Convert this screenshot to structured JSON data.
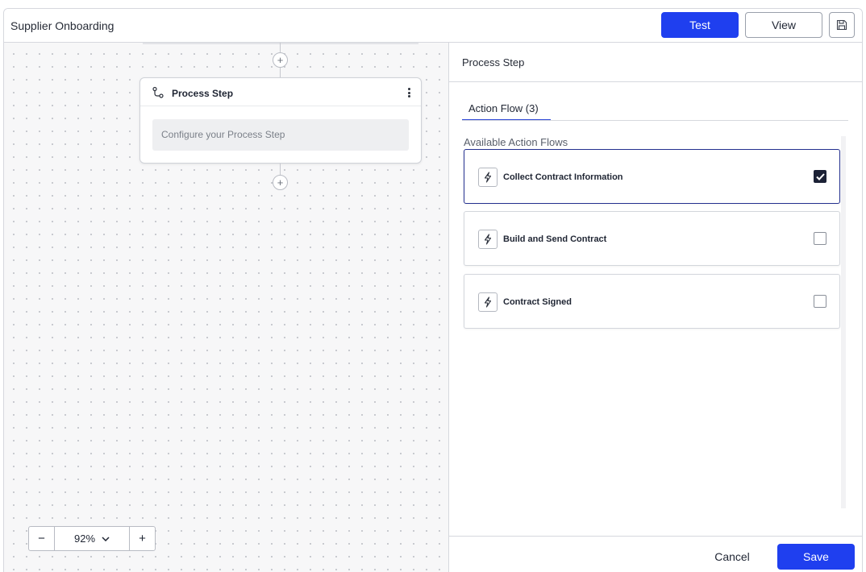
{
  "header": {
    "title": "Supplier Onboarding",
    "test_label": "Test",
    "view_label": "View",
    "save_icon": "floppy-disk-icon"
  },
  "canvas": {
    "node": {
      "title": "Process Step",
      "icon": "branch-icon",
      "placeholder": "Configure your Process Step"
    },
    "zoom": {
      "minus": "−",
      "value": "92%",
      "plus": "+"
    },
    "add_step_symbol": "+"
  },
  "panel": {
    "title": "Process Step",
    "tab_label": "Action Flow (3)",
    "section_label": "Available Action Flows",
    "flows": [
      {
        "label": "Collect Contract Information",
        "checked": true,
        "icon": "lightning-icon"
      },
      {
        "label": "Build and Send Contract",
        "checked": false,
        "icon": "lightning-icon"
      },
      {
        "label": "Contract Signed",
        "checked": false,
        "icon": "lightning-icon"
      }
    ],
    "cancel_label": "Cancel",
    "save_label": "Save"
  },
  "colors": {
    "primary": "#1f3fef",
    "selected_border": "#24308f",
    "checkbox_checked": "#1c2236"
  }
}
